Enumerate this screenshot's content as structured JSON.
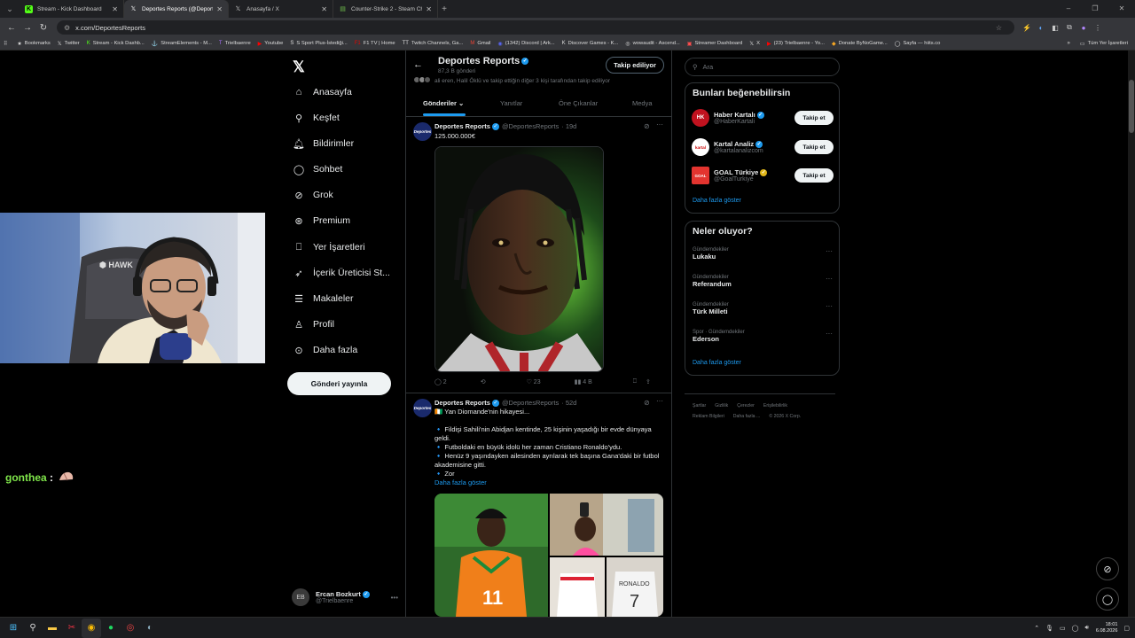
{
  "browser": {
    "tabs": [
      {
        "label": "Stream - Kick Dashboard",
        "icon": "kick-icon",
        "active": false
      },
      {
        "label": "Deportes Reports (@Deportes",
        "icon": "x-icon",
        "active": true
      },
      {
        "label": "Anasayfa / X",
        "icon": "x-icon",
        "active": false
      },
      {
        "label": "Counter-Strike 2 - Steam Charts",
        "icon": "steamcharts-icon",
        "active": false
      }
    ],
    "url": "x.com/DeportesReports",
    "bookmarks": [
      {
        "label": "Bookmarks",
        "icon": "star"
      },
      {
        "label": "Twitter",
        "icon": "X"
      },
      {
        "label": "Stream - Kick Dashb...",
        "icon": "K"
      },
      {
        "label": "StreamElements - M...",
        "icon": "⚓"
      },
      {
        "label": "Trielbaenre",
        "icon": "T"
      },
      {
        "label": "Youtube",
        "icon": "▶"
      },
      {
        "label": "S Sport Plus-İstediği...",
        "icon": "S"
      },
      {
        "label": "F1 TV | Home",
        "icon": "F1"
      },
      {
        "label": "Twitch Channels, Ga...",
        "icon": "TT"
      },
      {
        "label": "Gmail",
        "icon": "M"
      },
      {
        "label": "(1342) Discord | Ark...",
        "icon": "◉"
      },
      {
        "label": "Discover Games - K...",
        "icon": "K"
      },
      {
        "label": "wowaudit - Ascend...",
        "icon": "◎"
      },
      {
        "label": "Streamer Dashboard",
        "icon": "▣"
      },
      {
        "label": "X",
        "icon": "X"
      },
      {
        "label": "(23) Trielbaenre - Yo...",
        "icon": "▶"
      },
      {
        "label": "Donate ByNoGame...",
        "icon": "◆"
      },
      {
        "label": "Sayfa — hiits.co",
        "icon": "◯"
      }
    ],
    "all_bookmarks": "Tüm Yer İşaretleri"
  },
  "nav": {
    "items": [
      {
        "label": "Anasayfa",
        "icon": "home-icon",
        "glyph": "⌂"
      },
      {
        "label": "Keşfet",
        "icon": "search-icon",
        "glyph": "⚲"
      },
      {
        "label": "Bildirimler",
        "icon": "bell-icon",
        "glyph": "♫"
      },
      {
        "label": "Sohbet",
        "icon": "chat-icon",
        "glyph": "◯"
      },
      {
        "label": "Grok",
        "icon": "grok-icon",
        "glyph": "⊘"
      },
      {
        "label": "Premium",
        "icon": "premium-icon",
        "glyph": "⊛"
      },
      {
        "label": "Yer İşaretleri",
        "icon": "bookmark-icon",
        "glyph": "⎕"
      },
      {
        "label": "İçerik Üreticisi St...",
        "icon": "rocket-icon",
        "glyph": "➶"
      },
      {
        "label": "Makaleler",
        "icon": "article-icon",
        "glyph": "☰"
      },
      {
        "label": "Profil",
        "icon": "profile-icon",
        "glyph": "♙"
      },
      {
        "label": "Daha fazla",
        "icon": "more-icon",
        "glyph": "⋯"
      }
    ],
    "post_button": "Gönderi yayınla",
    "account": {
      "name": "Ercan Bozkurt",
      "handle": "@Trielbaenre"
    }
  },
  "chat": {
    "user": "gonthea",
    "sep": ":"
  },
  "profile_header": {
    "name": "Deportes Reports",
    "posts": "87,3 B gönderi",
    "followed_by": "ali eren, Halil Öklü ve takip ettiğin diğer 3 kişi tarafından takip ediliyor",
    "following_button": "Takip ediliyor",
    "tabs": [
      "Gönderiler",
      "Yanıtlar",
      "Öne Çıkanlar",
      "Medya"
    ]
  },
  "tweets": [
    {
      "name": "Deportes Reports",
      "handle": "@DeportesReports",
      "time": "· 19d",
      "avatar_text": "Deportes",
      "text": "125.000.000€",
      "replies": "2",
      "likes": "23",
      "views": "4 B"
    },
    {
      "name": "Deportes Reports",
      "handle": "@DeportesReports",
      "time": "· 52d",
      "avatar_text": "Deportes",
      "lines": [
        "🇨🇮 Yan Diomande'nin hikayesi...",
        "",
        "🔹 Fildişi Sahili'nin Abidjan kentinde, 25 kişinin yaşadığı bir evde dünyaya geldi.",
        "🔹 Futboldaki en büyük idolü her zaman Cristiano Ronaldo'ydu.",
        "🔹 Henüz 9 yaşındayken ailesinden ayrılarak tek başına Gana'daki bir futbol akademisine gitti.",
        "🔹 Zor"
      ],
      "show_more": "Daha fazla göster",
      "jersey_number": "11",
      "shirt_text": "RONALDO"
    }
  ],
  "sidebar": {
    "search_placeholder": "Ara",
    "suggest_title": "Bunları beğenebilirsin",
    "suggestions": [
      {
        "name": "Haber Kartalı",
        "handle": "@HaberKartali",
        "color": "#c1121f",
        "badge": "blue",
        "avatar_text": "HK"
      },
      {
        "name": "Kartal Analiz",
        "handle": "@kartalanalizcom",
        "color": "#ffffff",
        "badge": "blue",
        "avatar_text": "kartal"
      },
      {
        "name": "GOAL Türkiye",
        "handle": "@GoalTurkiye",
        "color": "#e3342f",
        "badge": "gold",
        "avatar_text": "GOAL"
      }
    ],
    "follow_label": "Takip et",
    "show_more": "Daha fazla göster",
    "trends_title": "Neler oluyor?",
    "trends": [
      {
        "context": "Gündemdekiler",
        "name": "Lukaku"
      },
      {
        "context": "Gündemdekiler",
        "name": "Referandum"
      },
      {
        "context": "Gündemdekiler",
        "name": "Türk Milleti"
      },
      {
        "context": "Spor · Gündemdekiler",
        "name": "Ederson"
      }
    ],
    "trends_more": "Daha fazla göster",
    "footer": [
      [
        "Şartlar",
        "Gizlilik",
        "Çerezler",
        "Erişilebilirlik"
      ],
      [
        "Reklam Bilgileri",
        "Daha fazla ...",
        "© 2026 X Corp."
      ]
    ]
  },
  "taskbar": {
    "time": "18:01",
    "date": "6.08.2026"
  }
}
